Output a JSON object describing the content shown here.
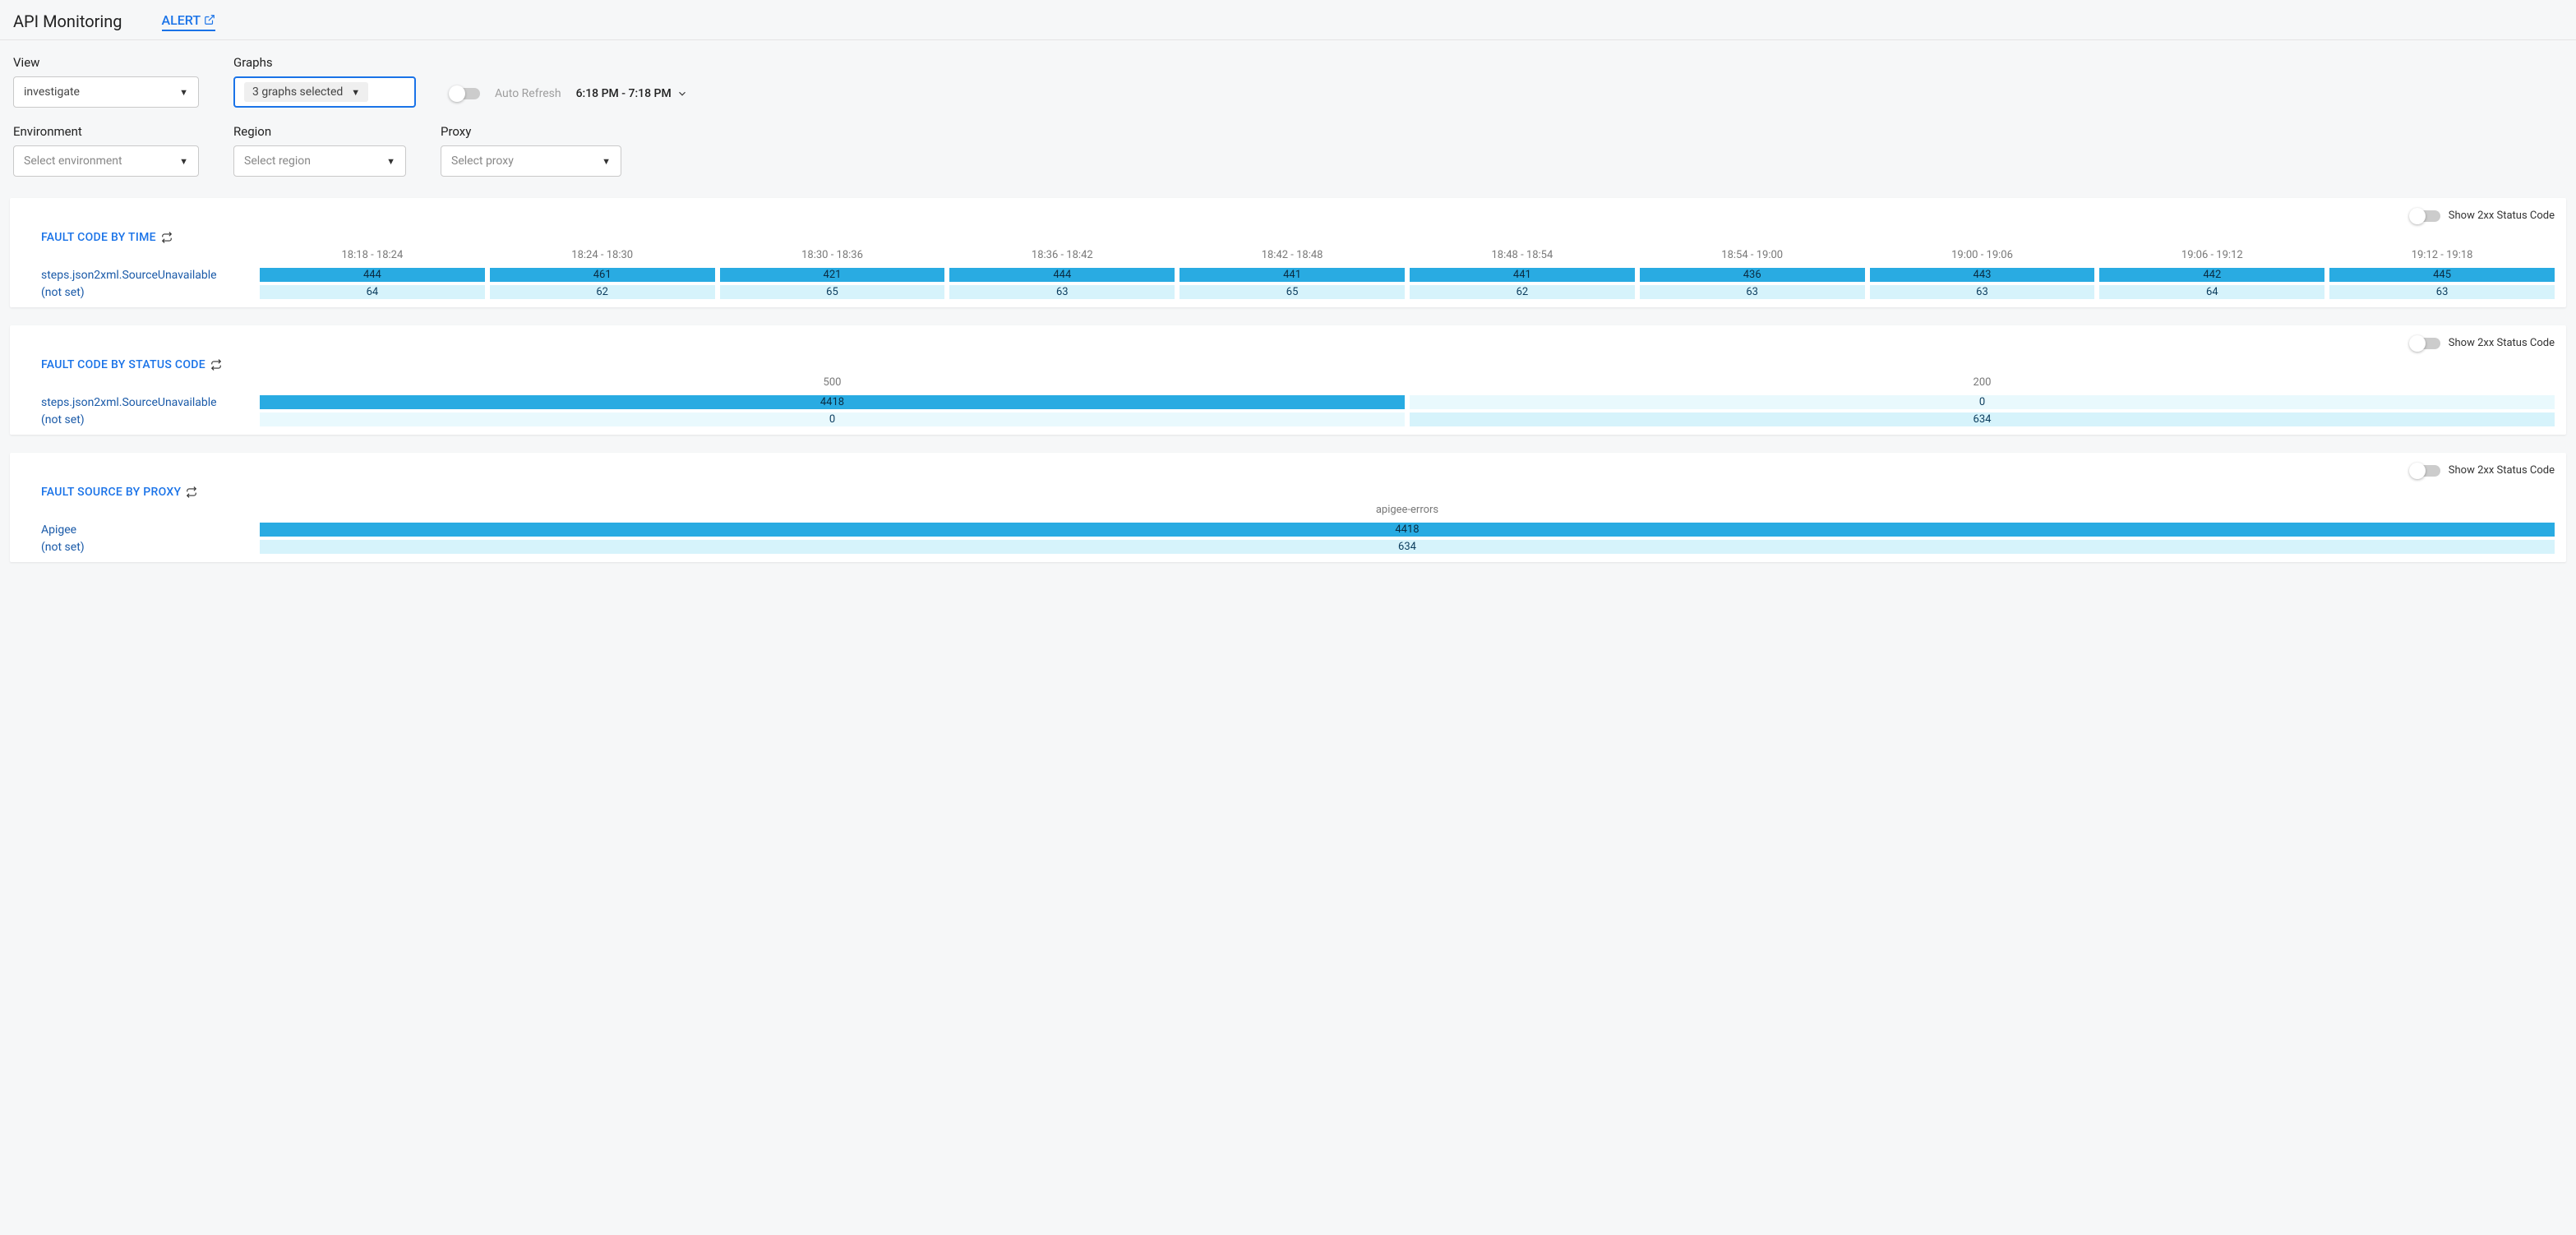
{
  "header": {
    "title": "API Monitoring",
    "alert_label": "ALERT"
  },
  "filters": {
    "view_label": "View",
    "view_value": "investigate",
    "graphs_label": "Graphs",
    "graphs_value": "3 graphs selected",
    "auto_refresh_label": "Auto Refresh",
    "time_range": "6:18 PM - 7:18 PM",
    "environment_label": "Environment",
    "environment_placeholder": "Select environment",
    "region_label": "Region",
    "region_placeholder": "Select region",
    "proxy_label": "Proxy",
    "proxy_placeholder": "Select proxy"
  },
  "show2xx_label": "Show 2xx Status Code",
  "cards": {
    "byTime": {
      "title": "FAULT CODE BY TIME",
      "time_headers": [
        "18:18 - 18:24",
        "18:24 - 18:30",
        "18:30 - 18:36",
        "18:36 - 18:42",
        "18:42 - 18:48",
        "18:48 - 18:54",
        "18:54 - 19:00",
        "19:00 - 19:06",
        "19:06 - 19:12",
        "19:12 - 19:18"
      ],
      "rows": [
        {
          "label": "steps.json2xml.SourceUnavailable",
          "values": [
            "444",
            "461",
            "421",
            "444",
            "441",
            "441",
            "436",
            "443",
            "442",
            "445"
          ],
          "shade": "dark"
        },
        {
          "label": "(not set)",
          "values": [
            "64",
            "62",
            "65",
            "63",
            "65",
            "62",
            "63",
            "63",
            "64",
            "63"
          ],
          "shade": "light"
        }
      ]
    },
    "byStatus": {
      "title": "FAULT CODE BY STATUS CODE",
      "headers": [
        "500",
        "200"
      ],
      "rows": [
        {
          "label": "steps.json2xml.SourceUnavailable",
          "values": [
            "4418",
            "0"
          ],
          "shades": [
            "dark",
            "xlight"
          ]
        },
        {
          "label": "(not set)",
          "values": [
            "0",
            "634"
          ],
          "shades": [
            "xlight",
            "light"
          ]
        }
      ]
    },
    "byProxy": {
      "title": "FAULT SOURCE BY PROXY",
      "headers": [
        "apigee-errors"
      ],
      "rows": [
        {
          "label": "Apigee",
          "values": [
            "4418"
          ],
          "shade": "dark"
        },
        {
          "label": "(not set)",
          "values": [
            "634"
          ],
          "shade": "light"
        }
      ]
    }
  },
  "chart_data": [
    {
      "type": "heatmap",
      "title": "FAULT CODE BY TIME",
      "x": [
        "18:18 - 18:24",
        "18:24 - 18:30",
        "18:30 - 18:36",
        "18:36 - 18:42",
        "18:42 - 18:48",
        "18:48 - 18:54",
        "18:54 - 19:00",
        "19:00 - 19:06",
        "19:06 - 19:12",
        "19:12 - 19:18"
      ],
      "series": [
        {
          "name": "steps.json2xml.SourceUnavailable",
          "values": [
            444,
            461,
            421,
            444,
            441,
            441,
            436,
            443,
            442,
            445
          ]
        },
        {
          "name": "(not set)",
          "values": [
            64,
            62,
            65,
            63,
            65,
            62,
            63,
            63,
            64,
            63
          ]
        }
      ]
    },
    {
      "type": "heatmap",
      "title": "FAULT CODE BY STATUS CODE",
      "x": [
        "500",
        "200"
      ],
      "series": [
        {
          "name": "steps.json2xml.SourceUnavailable",
          "values": [
            4418,
            0
          ]
        },
        {
          "name": "(not set)",
          "values": [
            0,
            634
          ]
        }
      ]
    },
    {
      "type": "heatmap",
      "title": "FAULT SOURCE BY PROXY",
      "x": [
        "apigee-errors"
      ],
      "series": [
        {
          "name": "Apigee",
          "values": [
            4418
          ]
        },
        {
          "name": "(not set)",
          "values": [
            634
          ]
        }
      ]
    }
  ]
}
